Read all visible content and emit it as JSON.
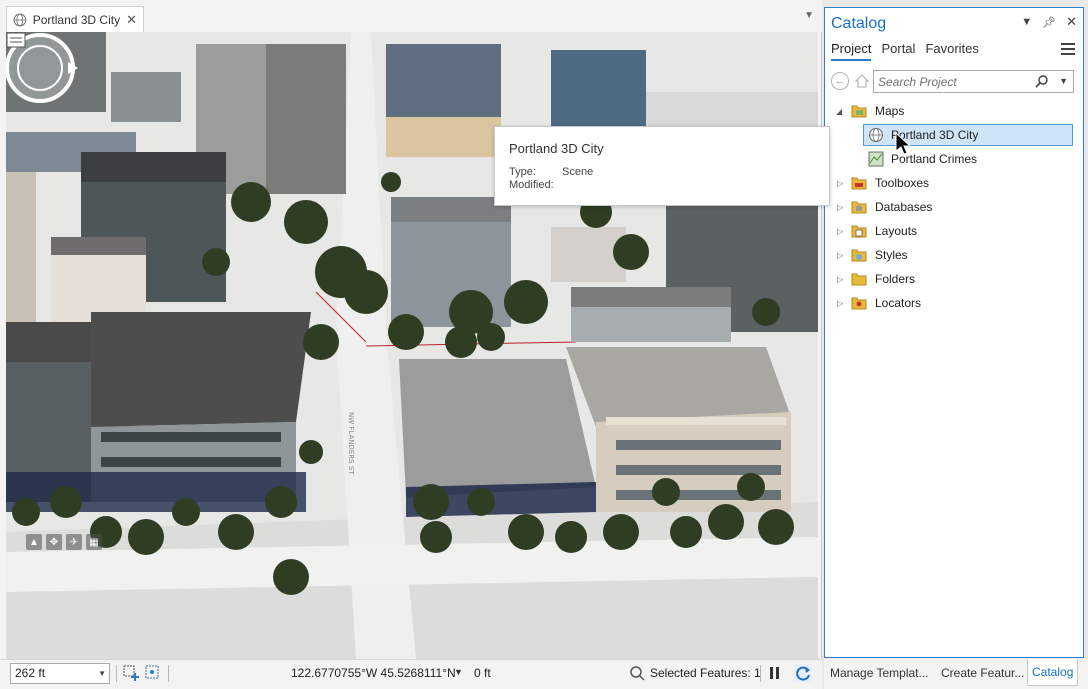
{
  "document_tab": {
    "title": "Portland 3D City",
    "close": "✕"
  },
  "tooltip": {
    "title": "Portland 3D City",
    "type_key": "Type:",
    "type_value": "Scene",
    "modified_key": "Modified:",
    "modified_value": ""
  },
  "street_labels": {
    "flanders": "NW FLANDERS ST"
  },
  "status_bar": {
    "scale": "262 ft",
    "coordinates": "122.6770755°W 45.5268111°N",
    "elevation": "0 ft",
    "selected_features": "Selected Features: 1"
  },
  "catalog": {
    "title": "Catalog",
    "tabs": [
      "Project",
      "Portal",
      "Favorites"
    ],
    "active_tab": "Project",
    "search": {
      "placeholder": "Search Project"
    },
    "tree": [
      {
        "label": "Maps",
        "expanded": true,
        "icon": "folder-maps-icon"
      },
      {
        "label": "Portland 3D City",
        "icon": "scene-icon",
        "selected": true
      },
      {
        "label": "Portland Crimes",
        "icon": "map-icon"
      },
      {
        "label": "Toolboxes",
        "icon": "toolbox-icon"
      },
      {
        "label": "Databases",
        "icon": "database-icon"
      },
      {
        "label": "Layouts",
        "icon": "layout-icon"
      },
      {
        "label": "Styles",
        "icon": "style-icon"
      },
      {
        "label": "Folders",
        "icon": "folder-icon"
      },
      {
        "label": "Locators",
        "icon": "locator-icon"
      }
    ]
  },
  "bottom_tabs": {
    "manage_templates": "Manage Templat...",
    "create_features": "Create Featur...",
    "catalog": "Catalog"
  },
  "colors": {
    "accent": "#1a6fc2",
    "selection": "#cfe4f7"
  }
}
